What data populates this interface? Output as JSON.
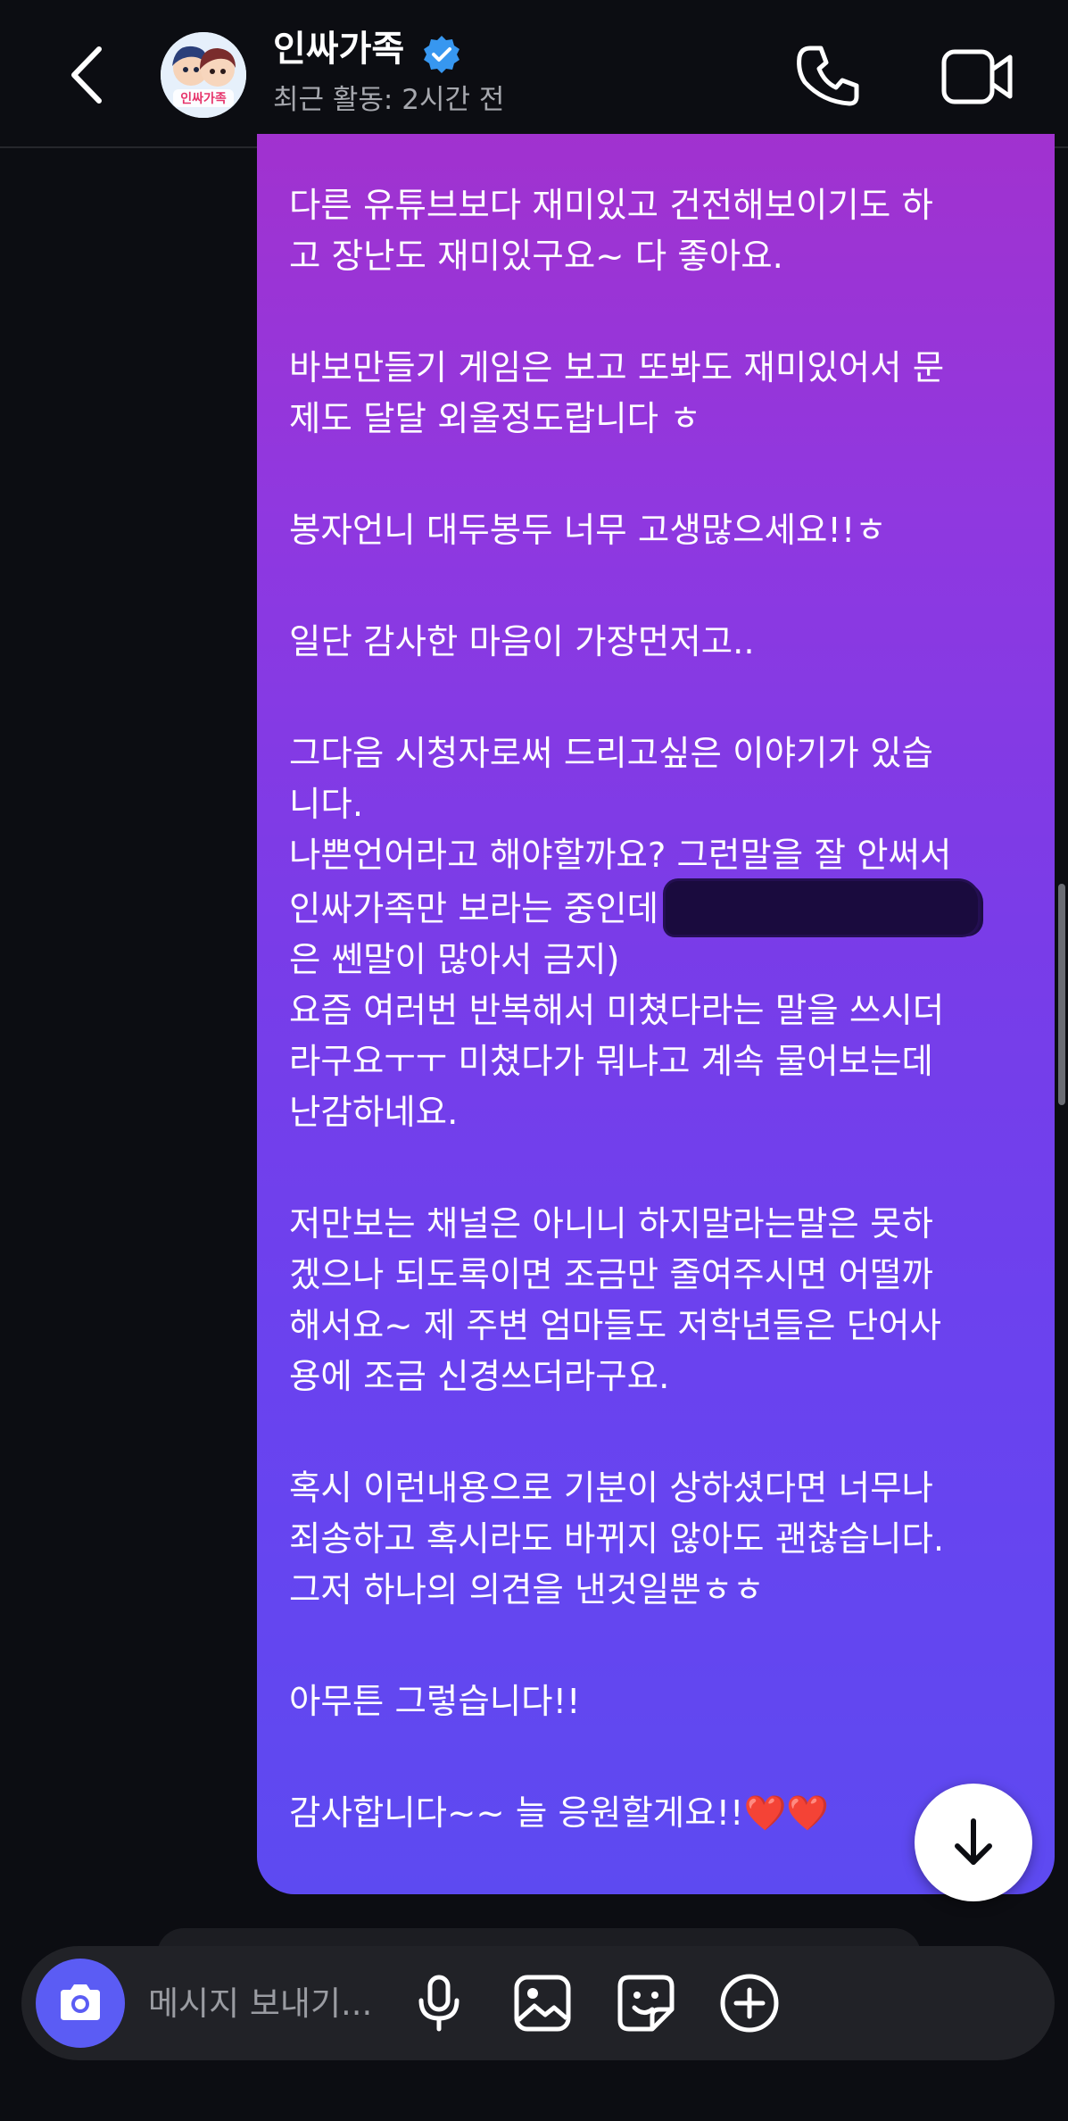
{
  "header": {
    "channel_name": "인싸가족",
    "activity": "최근 활동: 2시간 전",
    "avatar_label": "인싸가족"
  },
  "message": {
    "paragraphs": [
      "다른 유튜브보다 재미있고 건전해보이기도 하\n고 장난도 재미있구요~ 다 좋아요.",
      "바보만들기 게임은 보고 또봐도 재미있어서 문\n제도 달달 외울정도랍니다 ㅎ",
      "봉자언니 대두봉두 너무 고생많으세요!!ㅎ",
      "일단 감사한 마음이 가장먼저고..",
      "그다음 시청자로써 드리고싶은 이야기가 있습\n니다.",
      "나쁜언어라고 해야할까요? 그런말을 잘 안써서\n인싸가족만 보라는 중인데",
      "은 쎈말이 많아서 금지)\n요즘 여러번 반복해서 미쳤다라는 말을 쓰시더\n라구요ㅜㅜ 미쳤다가 뭐냐고 계속 물어보는데\n난감하네요.",
      "저만보는 채널은 아니니 하지말라는말은 못하\n겠으나 되도록이면 조금만 줄여주시면 어떨까\n해서요~ 제 주변 엄마들도 저학년들은 단어사\n용에 조금 신경쓰더라구요.",
      "혹시 이런내용으로 기분이 상하셨다면 너무나\n죄송하고 혹시라도 바뀌지 않아도 괜찮습니다.\n그저 하나의 의견을 낸것일뿐ㅎㅎ",
      "아무튼 그렇습니다!!",
      "감사합니다~~ 늘 응원할게요!!❤️❤️"
    ]
  },
  "composer": {
    "placeholder": "메시지 보내기..."
  },
  "colors": {
    "bubble_top": "#a132cf",
    "bubble_bottom": "#5d4af1",
    "camera_button": "#5b5cf4",
    "background": "#0c0d12",
    "verified_badge": "#3797f0"
  },
  "icons": {
    "back": "chevron-left-icon",
    "verified": "verified-badge-icon",
    "call": "phone-icon",
    "video": "video-camera-icon",
    "scroll_down": "arrow-down-icon",
    "camera": "camera-icon",
    "mic": "microphone-icon",
    "gallery": "image-icon",
    "sticker": "sticker-icon",
    "add": "plus-circle-icon"
  }
}
